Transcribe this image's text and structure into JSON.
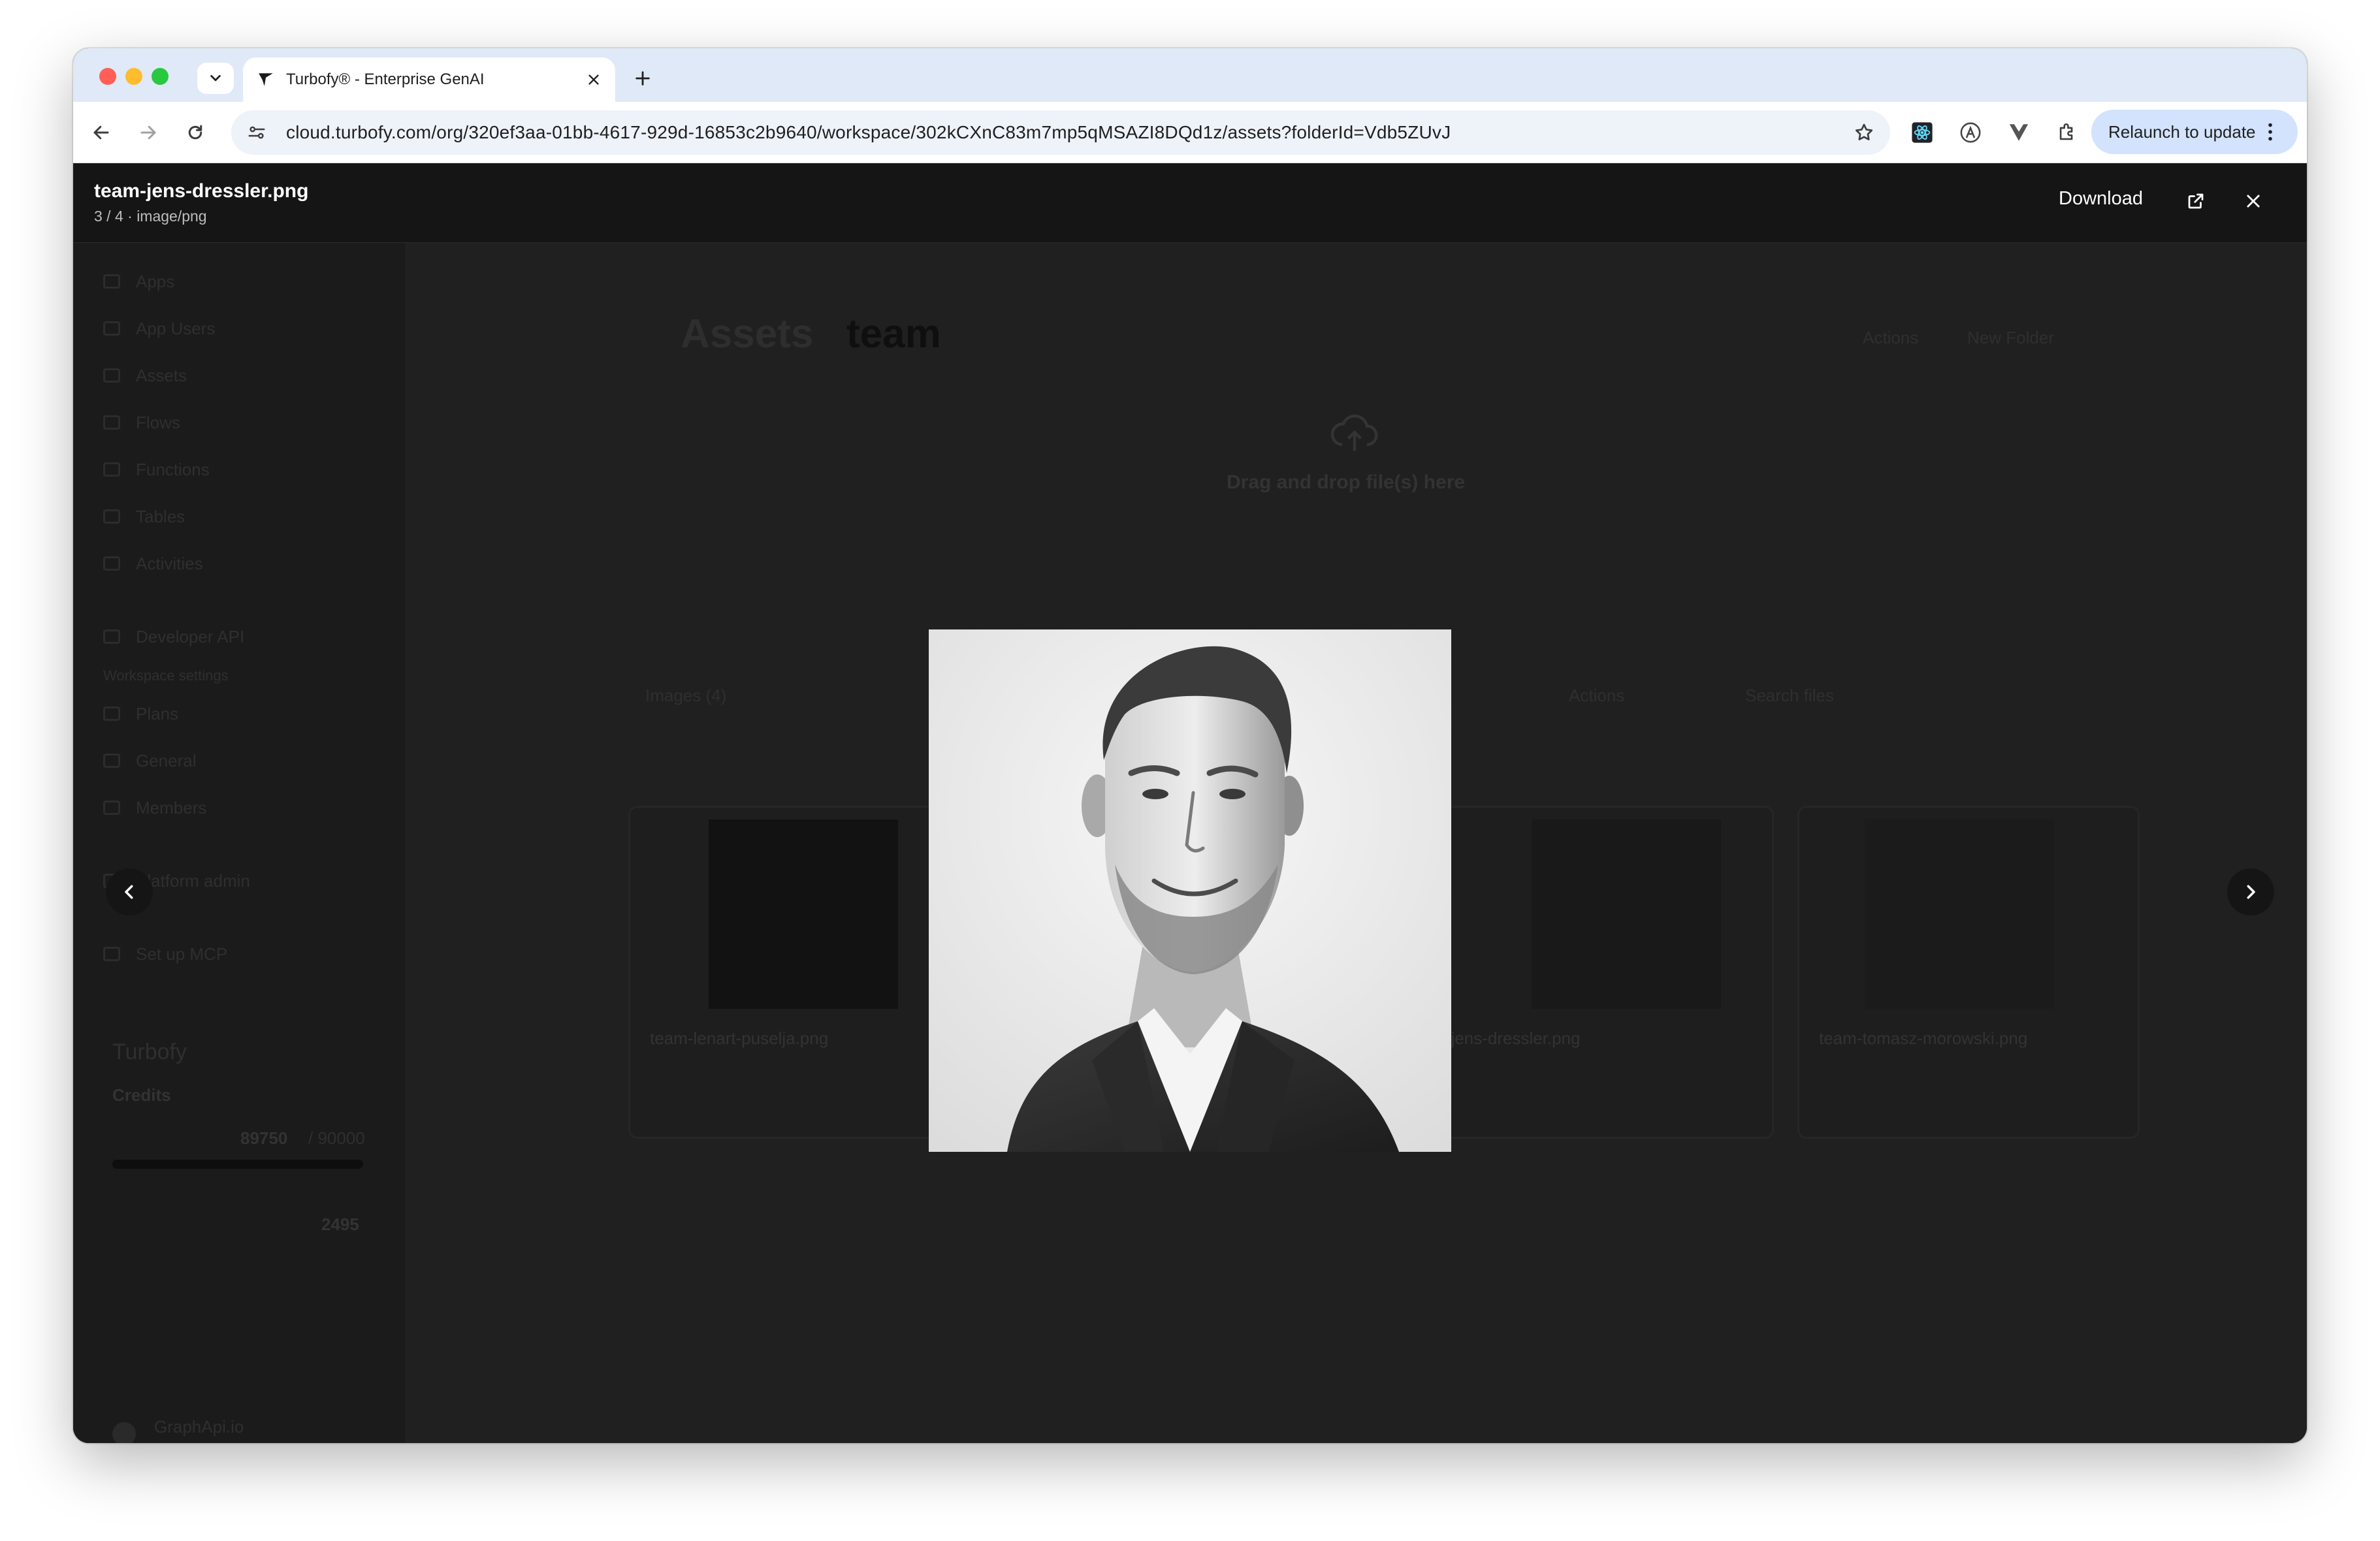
{
  "browser": {
    "tab_title": "Turbofy® - Enterprise GenAI",
    "url": "cloud.turbofy.com/org/320ef3aa-01bb-4617-929d-16853c2b9640/workspace/302kCXnC83m7mp5qMSAZI8DQd1z/assets?folderId=Vdb5ZUvJ",
    "relaunch_label": "Relaunch to update"
  },
  "viewer": {
    "file_name": "team-jens-dressler.png",
    "file_meta": "3 / 4 · image/png",
    "download_label": "Download"
  },
  "background": {
    "sidebar_items": [
      "Apps",
      "App Users",
      "Assets",
      "Flows",
      "Functions",
      "Tables",
      "Activities"
    ],
    "developer_api": "Developer API",
    "workspace_settings": "Workspace settings",
    "settings_items": [
      "Plans",
      "General",
      "Members"
    ],
    "platform_admin": "Platform admin",
    "setup_mcp": "Set up MCP",
    "brand": "Turbofy",
    "credits_label": "Credits",
    "credits_used": "89750",
    "credits_total": "/ 90000",
    "credits_other": "2495",
    "workspace_name": "GraphApi.io",
    "breadcrumb_root": "Assets",
    "breadcrumb_current": "team",
    "action_label": "Actions",
    "new_folder_label": "New Folder",
    "drop_title": "Drag and drop file(s) here",
    "images_label": "Images (4)",
    "search_placeholder": "Search files",
    "cards": [
      {
        "name": "team-lenart-puselja.png"
      },
      {
        "name": "team-jens-dressler.png"
      },
      {
        "name": "team-tomasz-morowski.png"
      }
    ]
  },
  "colors": {
    "tabstrip": "#dfe9f7",
    "relaunch_bg": "#d3e3fd",
    "viewer_header": "#151515",
    "overlay_bg": "#202020"
  }
}
